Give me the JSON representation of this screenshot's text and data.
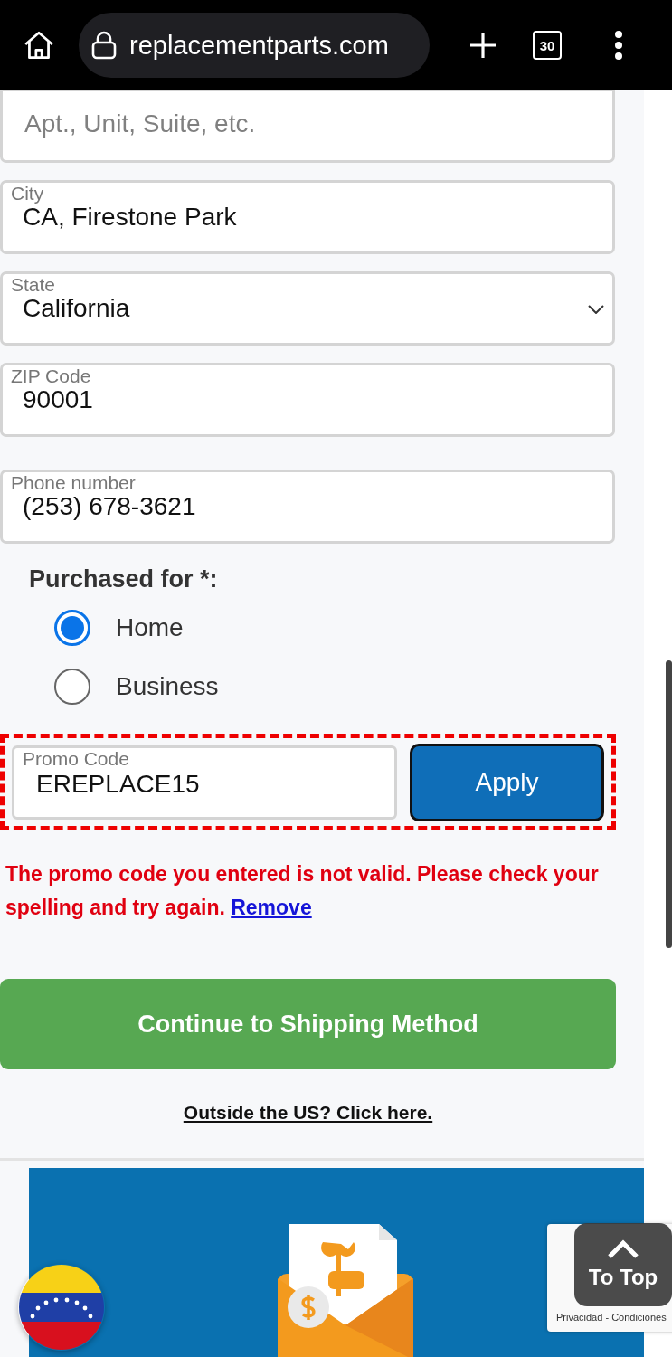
{
  "browser": {
    "url": "replacementparts.com",
    "tab_count": "30"
  },
  "fields": [
    {
      "kind": "text",
      "placeholder": "Apt., Unit, Suite, etc."
    },
    {
      "kind": "text",
      "label": "City",
      "value": "CA, Firestone Park"
    },
    {
      "kind": "select",
      "label": "State",
      "value": "California"
    },
    {
      "kind": "text",
      "label": "ZIP Code",
      "value": "90001"
    },
    {
      "kind": "text",
      "label": "Phone number",
      "value": "(253) 678-3621"
    }
  ],
  "purchased_for": {
    "label": "Purchased for *:",
    "options": [
      {
        "label": "Home",
        "selected": true
      },
      {
        "label": "Business",
        "selected": false
      }
    ]
  },
  "promo": {
    "label": "Promo Code",
    "value": "EREPLACE15",
    "button": "Apply"
  },
  "error": {
    "text": "The promo code you entered is not valid. Please check your spelling and try again.",
    "link": "Remove"
  },
  "continue_button": "Continue to Shipping Method",
  "outside_link": "Outside the US? Click here.",
  "recaptcha_text": "Privacidad - Condiciones",
  "to_top": "To Top"
}
